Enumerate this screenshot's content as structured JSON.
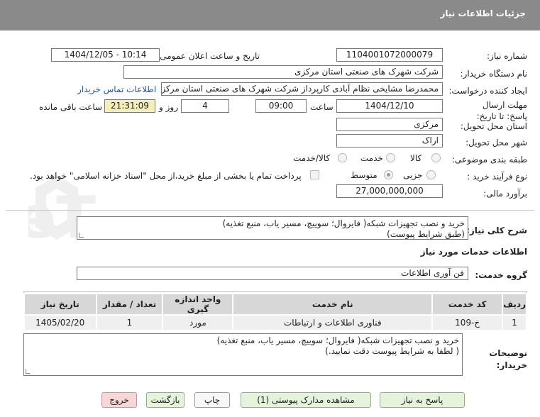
{
  "header": {
    "title": "جزئیات اطلاعات نیاز"
  },
  "form": {
    "need_number_label": "شماره نیاز:",
    "need_number": "1104001072000079",
    "announce_label": "تاریخ و ساعت اعلان عمومی:",
    "announce_value": "1404/12/05 - 10:14",
    "buyer_org_label": "نام دستگاه خریدار:",
    "buyer_org": "شرکت شهرک های صنعتی استان مرکزی",
    "creator_label": "ایجاد کننده درخواست:",
    "creator": "محمدرضا مشایخی نظام آبادی کارپرداز شرکت شهرک های صنعتی استان مرکزی",
    "contact_link": "اطلاعات تماس خریدار",
    "deadline_label": "مهلت ارسال پاسخ: تا تاریخ:",
    "deadline_date": "1404/12/10",
    "time_label": "ساعت",
    "deadline_time": "09:00",
    "days_value": "4",
    "days_label": "روز و",
    "remaining_time": "21:31:09",
    "remaining_label": "ساعت باقی مانده",
    "province_label": "استان محل تحویل:",
    "province": "مرکزی",
    "city_label": "شهر محل تحویل:",
    "city": "اراک",
    "category_label": "طبقه بندی موضوعی:",
    "category_options": [
      "کالا",
      "خدمت",
      "کالا/خدمت"
    ],
    "category_selected": "خدمت",
    "process_label": "نوع فرآیند خرید :",
    "process_options": [
      "جزیی",
      "متوسط"
    ],
    "process_selected": "متوسط",
    "payment_note": "پرداخت تمام یا بخشی از مبلغ خرید،از محل \"اسناد خزانه اسلامی\" خواهد بود.",
    "estimate_label": "برآورد مالی:",
    "estimate": "27,000,000,000"
  },
  "summary": {
    "label": "شرح کلی نیاز:",
    "line1": "خرید و نصب تجهیزات شبکه( فایروال؛ سوییچ، مسیر یاب، منبع تغذیه)",
    "line2": "(طبق شرایط پیوست)"
  },
  "services": {
    "section_title": "اطلاعات خدمات مورد نیاز",
    "group_label": "گروه خدمت:",
    "group_value": "فن آوری اطلاعات"
  },
  "table": {
    "headers": [
      "ردیف",
      "کد خدمت",
      "نام خدمت",
      "واحد اندازه گیری",
      "تعداد / مقدار",
      "تاریخ نیاز"
    ],
    "rows": [
      [
        "1",
        "خ-109",
        "فناوری اطلاعات و ارتباطات",
        "مورد",
        "1",
        "1405/02/20"
      ]
    ]
  },
  "buyer_notes": {
    "label": "توضیحات خریدار:",
    "line1": "خرید و نصب تجهیزات شبکه( فایروال؛ سوییچ، مسیر یاب، منبع تغذیه)",
    "line2": "( لطفا به شرایط پیوست دقت نمایید.)"
  },
  "buttons": {
    "reply": "پاسخ به نیاز",
    "attachments": "مشاهده مدارک پیوستی (1)",
    "print": "چاپ",
    "back": "بازگشت",
    "exit": "خروج"
  },
  "watermark": {
    "text": "AriaTender.neT"
  },
  "colors": {
    "header": "#8a8a8a",
    "link": "#1a55c8",
    "remaining_bg": "#f3efb8",
    "exit_bg": "#f6d6d6",
    "reply_bg": "#e6f3dc"
  }
}
